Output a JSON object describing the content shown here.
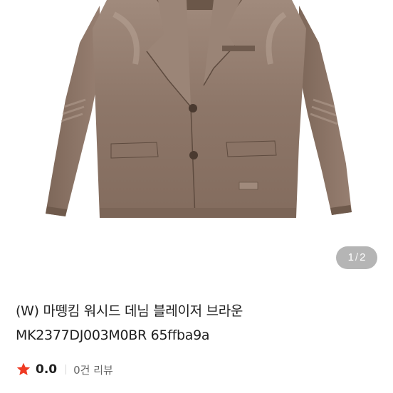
{
  "gallery": {
    "current": "1",
    "separator": "/",
    "total": "2",
    "image_subject": "jacket-photo"
  },
  "product": {
    "title": "(W) 마뗑킴 워시드 데님 블레이저 브라운 MK2377DJ003M0BR 65ffba9a",
    "rating": "0.0",
    "review_count_label": "0건 리뷰"
  },
  "colors": {
    "star": "#ef3b24",
    "jacket": "#8a7466"
  }
}
